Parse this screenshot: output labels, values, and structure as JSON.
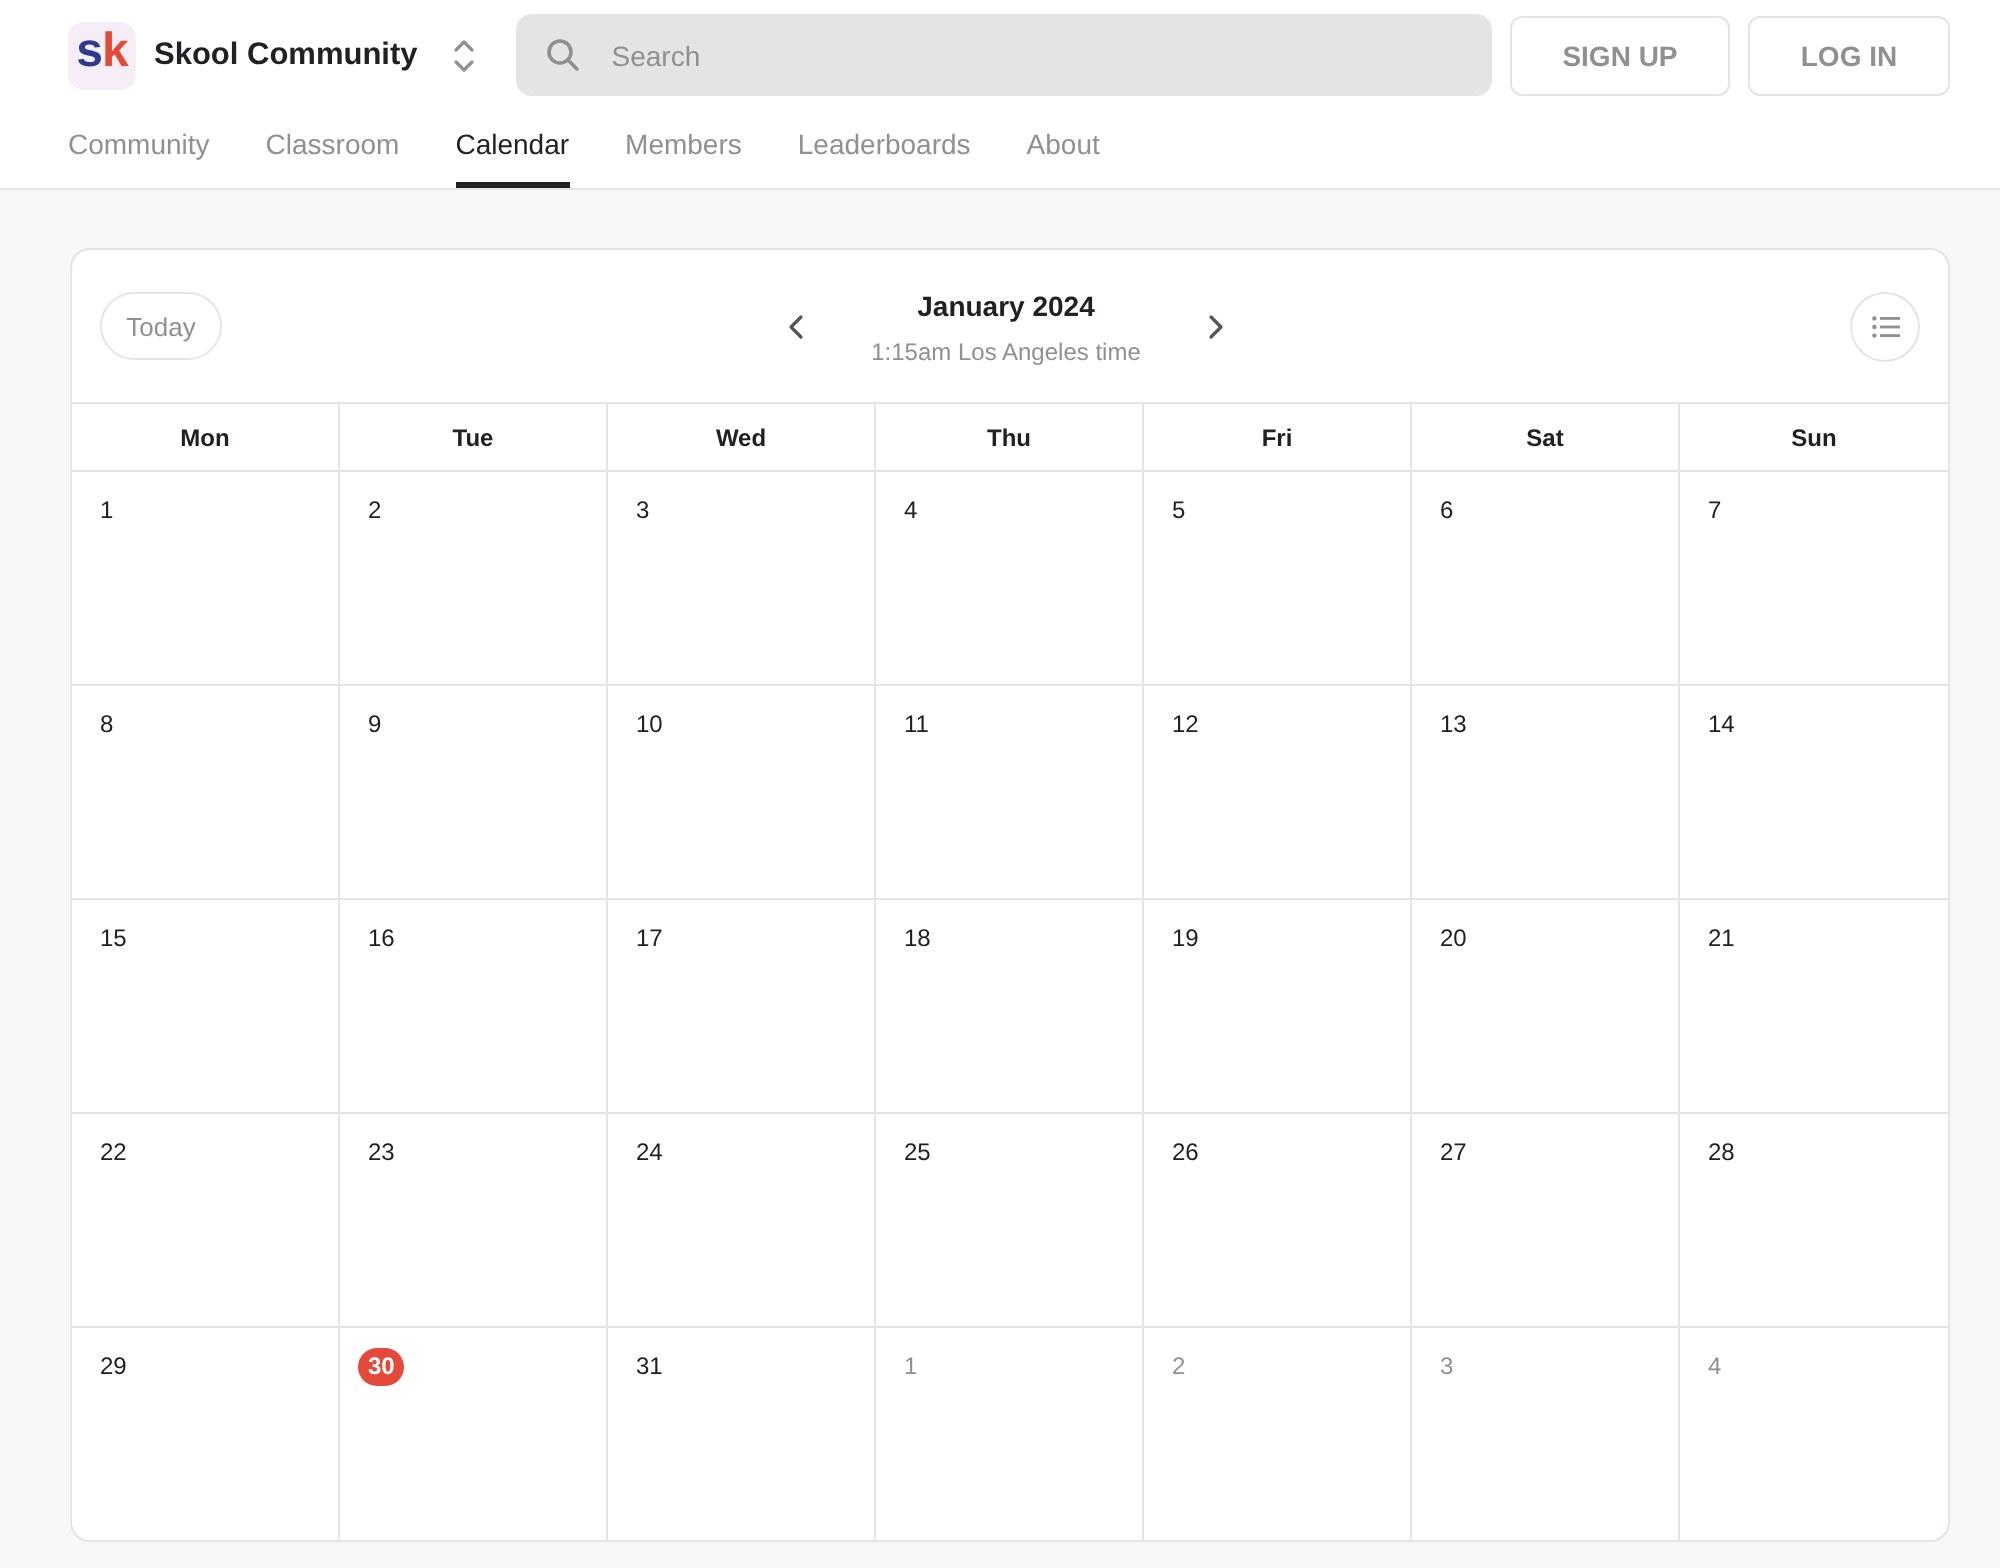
{
  "header": {
    "logo": {
      "letters": [
        {
          "text": "s",
          "color": "#2e3a8c"
        },
        {
          "text": "k",
          "color": "#e5493a"
        }
      ]
    },
    "community_name": "Skool Community",
    "search": {
      "placeholder": "Search"
    },
    "buttons": [
      "SIGN UP",
      "LOG IN"
    ]
  },
  "tabs": [
    {
      "label": "Community",
      "selected": false
    },
    {
      "label": "Classroom",
      "selected": false
    },
    {
      "label": "Calendar",
      "selected": true
    },
    {
      "label": "Members",
      "selected": false
    },
    {
      "label": "Leaderboards",
      "selected": false
    },
    {
      "label": "About",
      "selected": false
    }
  ],
  "calendar": {
    "today_button": "Today",
    "month": "January 2024",
    "local_time": "1:15am Los Angeles time",
    "weekdays": [
      "Mon",
      "Tue",
      "Wed",
      "Thu",
      "Fri",
      "Sat",
      "Sun"
    ],
    "weeks": [
      {
        "days": [
          {
            "day": "1",
            "in_month": true,
            "today": false
          },
          {
            "day": "2",
            "in_month": true,
            "today": false
          },
          {
            "day": "3",
            "in_month": true,
            "today": false
          },
          {
            "day": "4",
            "in_month": true,
            "today": false
          },
          {
            "day": "5",
            "in_month": true,
            "today": false
          },
          {
            "day": "6",
            "in_month": true,
            "today": false
          },
          {
            "day": "7",
            "in_month": true,
            "today": false
          }
        ]
      },
      {
        "days": [
          {
            "day": "8",
            "in_month": true,
            "today": false
          },
          {
            "day": "9",
            "in_month": true,
            "today": false
          },
          {
            "day": "10",
            "in_month": true,
            "today": false
          },
          {
            "day": "11",
            "in_month": true,
            "today": false
          },
          {
            "day": "12",
            "in_month": true,
            "today": false
          },
          {
            "day": "13",
            "in_month": true,
            "today": false
          },
          {
            "day": "14",
            "in_month": true,
            "today": false
          }
        ]
      },
      {
        "days": [
          {
            "day": "15",
            "in_month": true,
            "today": false
          },
          {
            "day": "16",
            "in_month": true,
            "today": false
          },
          {
            "day": "17",
            "in_month": true,
            "today": false
          },
          {
            "day": "18",
            "in_month": true,
            "today": false
          },
          {
            "day": "19",
            "in_month": true,
            "today": false
          },
          {
            "day": "20",
            "in_month": true,
            "today": false
          },
          {
            "day": "21",
            "in_month": true,
            "today": false
          }
        ]
      },
      {
        "days": [
          {
            "day": "22",
            "in_month": true,
            "today": false
          },
          {
            "day": "23",
            "in_month": true,
            "today": false
          },
          {
            "day": "24",
            "in_month": true,
            "today": false
          },
          {
            "day": "25",
            "in_month": true,
            "today": false
          },
          {
            "day": "26",
            "in_month": true,
            "today": false
          },
          {
            "day": "27",
            "in_month": true,
            "today": false
          },
          {
            "day": "28",
            "in_month": true,
            "today": false
          }
        ]
      },
      {
        "days": [
          {
            "day": "29",
            "in_month": true,
            "today": false
          },
          {
            "day": "30",
            "in_month": true,
            "today": true
          },
          {
            "day": "31",
            "in_month": true,
            "today": false
          },
          {
            "day": "1",
            "in_month": false,
            "today": false
          },
          {
            "day": "2",
            "in_month": false,
            "today": false
          },
          {
            "day": "3",
            "in_month": false,
            "today": false
          },
          {
            "day": "4",
            "in_month": false,
            "today": false
          }
        ]
      }
    ]
  }
}
